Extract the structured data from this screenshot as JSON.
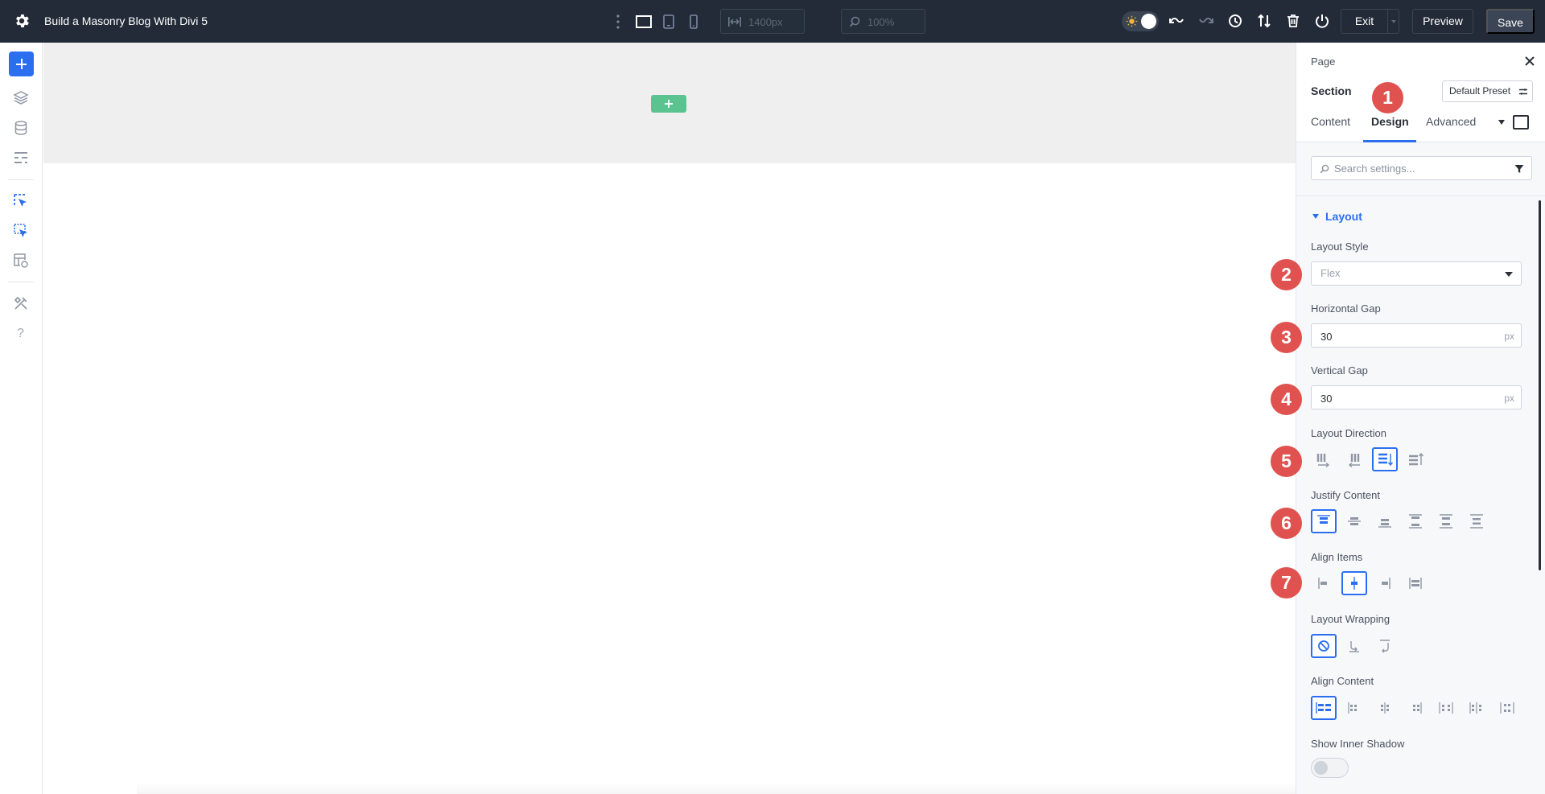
{
  "topbar": {
    "title": "Build a Masonry Blog With Divi 5",
    "width_value": "1400px",
    "zoom_value": "100%",
    "exit_label": "Exit",
    "preview_label": "Preview",
    "save_label": "Save"
  },
  "canvas": {
    "section_bg": "#efefef",
    "add_row_color": "#5bc38f"
  },
  "panel": {
    "breadcrumb": "Page",
    "element_title": "Section",
    "preset_label": "Default Preset",
    "tabs": [
      {
        "label": "Content"
      },
      {
        "label": "Design"
      },
      {
        "label": "Advanced"
      }
    ],
    "active_tab": "Design",
    "search_placeholder": "Search settings...",
    "group_title": "Layout",
    "layout_style": {
      "label": "Layout Style",
      "value": "Flex"
    },
    "horizontal_gap": {
      "label": "Horizontal Gap",
      "value": "30",
      "unit": "px"
    },
    "vertical_gap": {
      "label": "Vertical Gap",
      "value": "30",
      "unit": "px"
    },
    "layout_direction": {
      "label": "Layout Direction",
      "selected_index": 2
    },
    "justify_content": {
      "label": "Justify Content",
      "selected_index": 0
    },
    "align_items": {
      "label": "Align Items",
      "selected_index": 1
    },
    "layout_wrapping": {
      "label": "Layout Wrapping",
      "selected_index": 0
    },
    "align_content": {
      "label": "Align Content",
      "selected_index": 0
    },
    "inner_shadow": {
      "label": "Show Inner Shadow",
      "enabled": false
    }
  },
  "badges": [
    "1",
    "2",
    "3",
    "4",
    "5",
    "6",
    "7"
  ],
  "colors": {
    "accent": "#2b6ff0",
    "badge": "#e0524f",
    "topbar": "#232b38"
  }
}
